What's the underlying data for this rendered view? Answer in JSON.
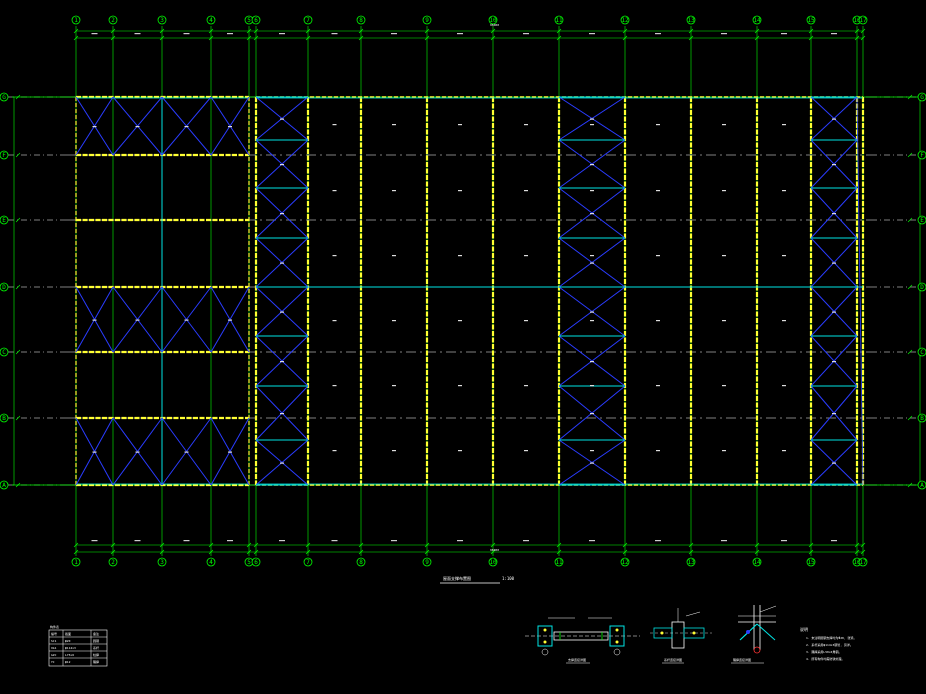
{
  "drawing": {
    "title": "屋面支撑布置图",
    "scale": "1:100",
    "top_overall_dim": "96000",
    "bottom_overall_dim": "96000",
    "col_axes": [
      "1",
      "2",
      "3",
      "4",
      "5",
      "6",
      "7",
      "8",
      "9",
      "10",
      "11",
      "12",
      "13",
      "14",
      "15",
      "16",
      "17"
    ],
    "row_axes": [
      "A",
      "B",
      "C",
      "D",
      "E",
      "F",
      "G"
    ]
  },
  "legend_table": {
    "title": "构件表",
    "header": [
      "编号",
      "截面",
      "备注"
    ],
    "rows": [
      [
        "SC1",
        "φ20",
        "圆钢"
      ],
      [
        "XG1",
        "φ114x3",
        "系杆"
      ],
      [
        "GZC",
        "L75x6",
        "柱撑"
      ],
      [
        "YC",
        "φ12",
        "隅撑"
      ]
    ]
  },
  "details": [
    {
      "label": "支撑连接详图"
    },
    {
      "label": "系杆连接详图"
    },
    {
      "label": "隅撑连接详图"
    }
  ],
  "notes": {
    "title": "说明",
    "lines": [
      "1. 未注明圆钢支撑均为Φ20, 张紧。",
      "2. 系杆采用φ114x3钢管, 另详。",
      "3. 隅撑采用L50x4角钢。",
      "4. 所有构件均需防锈处理。"
    ]
  },
  "colors": {
    "background": "#000000",
    "grid": "#00ff00",
    "bracing": "#2a3cff",
    "beam": "#00e5e5",
    "strut": "#ffff33",
    "text": "#ffffff"
  }
}
